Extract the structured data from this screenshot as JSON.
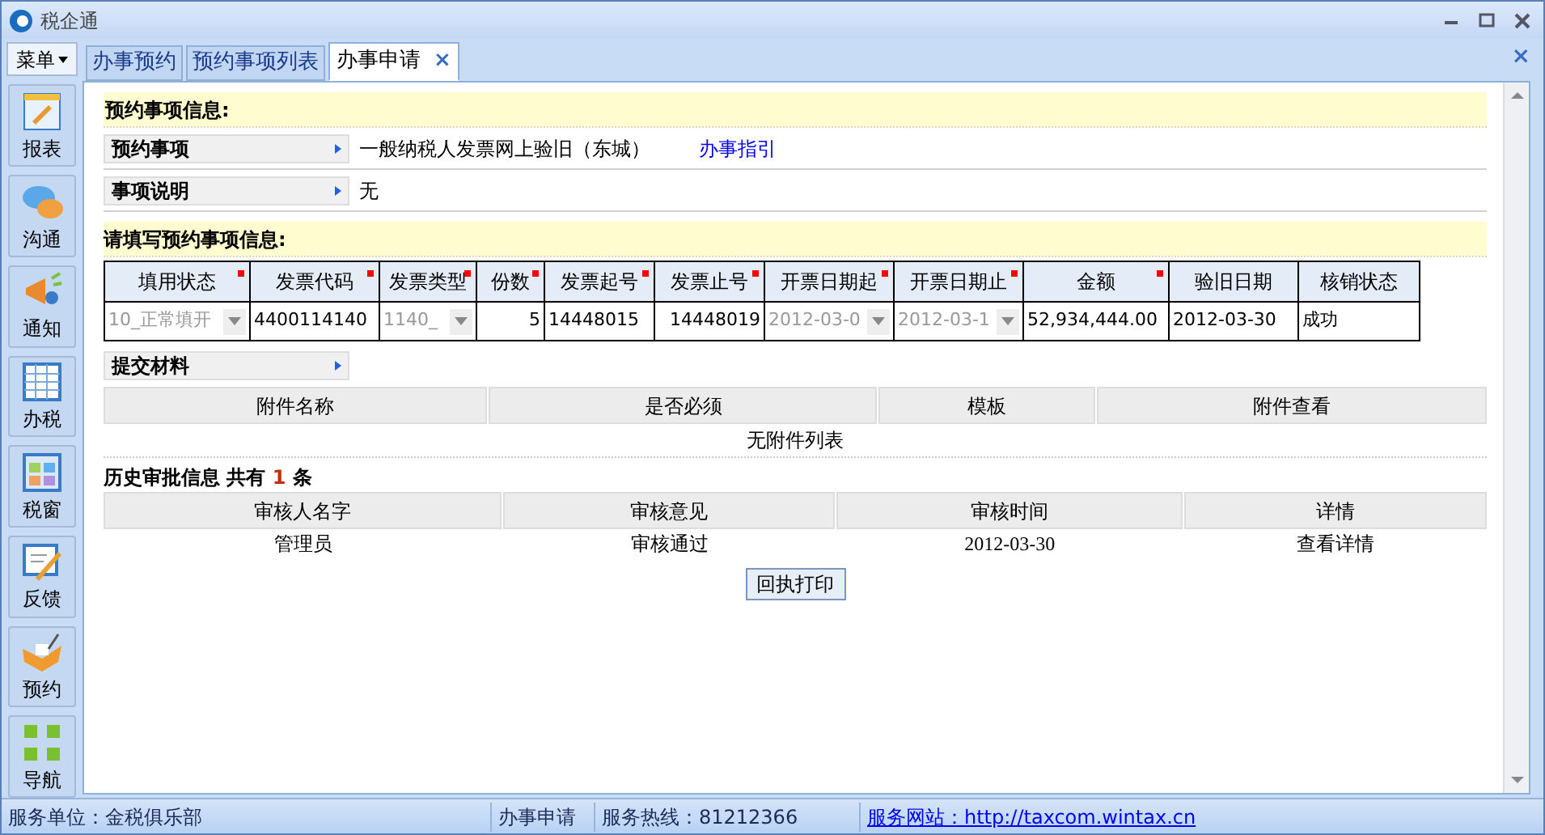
{
  "window": {
    "title": "税企通"
  },
  "menu_button": "菜单",
  "tabs": [
    {
      "label": "办事预约",
      "selected": false,
      "closable": false
    },
    {
      "label": "预约事项列表",
      "selected": false,
      "closable": false
    },
    {
      "label": "办事申请",
      "selected": true,
      "closable": true
    }
  ],
  "close_symbol": "×",
  "sidebar": {
    "items": [
      {
        "label": "报表",
        "kind": "report"
      },
      {
        "label": "沟通",
        "kind": "chat"
      },
      {
        "label": "通知",
        "kind": "notice"
      },
      {
        "label": "办税",
        "kind": "grid"
      },
      {
        "label": "税窗",
        "kind": "window"
      },
      {
        "label": "反馈",
        "kind": "feedback"
      },
      {
        "label": "预约",
        "kind": "booking"
      },
      {
        "label": "导航",
        "kind": "nav"
      }
    ]
  },
  "info_section": {
    "title": "预约事项信息:",
    "fields": [
      {
        "label": "预约事项",
        "value": "一般纳税人发票网上验旧（东城）",
        "link": "办事指引"
      },
      {
        "label": "事项说明",
        "value": "无"
      }
    ]
  },
  "invoice_section": {
    "title": "请填写预约事项信息:",
    "columns": [
      {
        "label": "填用状态",
        "required": true
      },
      {
        "label": "发票代码",
        "required": true
      },
      {
        "label": "发票类型",
        "required": true
      },
      {
        "label": "份数",
        "required": true
      },
      {
        "label": "发票起号",
        "required": true
      },
      {
        "label": "发票止号",
        "required": true
      },
      {
        "label": "开票日期起",
        "required": true
      },
      {
        "label": "开票日期止",
        "required": true
      },
      {
        "label": "金额",
        "required": true
      },
      {
        "label": "验旧日期",
        "required": false
      },
      {
        "label": "核销状态",
        "required": false
      }
    ],
    "row": [
      {
        "kind": "select",
        "value": "10_正常填开",
        "disabled": true
      },
      {
        "kind": "text",
        "value": "4400114140"
      },
      {
        "kind": "select",
        "value": "1140_",
        "disabled": true
      },
      {
        "kind": "number",
        "value": "5"
      },
      {
        "kind": "text",
        "value": "14448015"
      },
      {
        "kind": "number",
        "value": "14448019"
      },
      {
        "kind": "select",
        "value": "2012-03-0",
        "disabled": true
      },
      {
        "kind": "select",
        "value": "2012-03-1",
        "disabled": true
      },
      {
        "kind": "text",
        "value": "52,934,444.00"
      },
      {
        "kind": "text",
        "value": "2012-03-30"
      },
      {
        "kind": "text",
        "value": "成功"
      }
    ]
  },
  "materials": {
    "label": "提交材料",
    "columns": [
      "附件名称",
      "是否必须",
      "模板",
      "附件查看"
    ],
    "empty": "无附件列表"
  },
  "history": {
    "title": "历史审批信息 共有",
    "count": "1",
    "unit": "条",
    "columns": [
      "审核人名字",
      "审核意见",
      "审核时间",
      "详情"
    ],
    "rows": [
      [
        "管理员",
        "审核通过",
        "2012-03-30",
        "查看详情"
      ]
    ]
  },
  "print_button": "回执打印",
  "status_bar": {
    "unit": "服务单位：金税俱乐部",
    "page": "办事申请",
    "hotline": "服务热线：81212366",
    "website": "服务网站：http://taxcom.wintax.cn"
  }
}
